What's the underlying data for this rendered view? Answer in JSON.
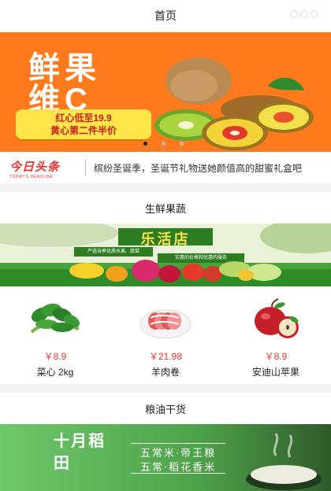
{
  "nav": {
    "title": "首页"
  },
  "banner": {
    "headline_line1": "鲜果",
    "headline_line2": "维C",
    "tag_line1": "红心低至19.9",
    "tag_line2": "黄心第二件半价",
    "slide_count": 3,
    "active_slide": 1
  },
  "news": {
    "logo_text": "今日头条",
    "logo_sub": "TODAY'S HEADLINE",
    "message": "缤纷圣诞季，圣诞节礼物送她颜值高的甜蜜礼盒吧"
  },
  "sections": [
    {
      "title": "生鲜果蔬",
      "banner_text": "乐活店",
      "banner_sub1": "严选当季优质水果、蔬菜",
      "banner_sub2": "实惠的价格和优惠的服务",
      "products": [
        {
          "price": "￥8.9",
          "name": "菜心 2kg",
          "icon": "vegetable-icon"
        },
        {
          "price": "￥21.98",
          "name": "羊肉卷",
          "icon": "lamb-roll-icon"
        },
        {
          "price": "￥8.9",
          "name": "安迪山苹果",
          "icon": "apple-icon"
        }
      ]
    },
    {
      "title": "粮油干货",
      "banner_brand": "十月稻田",
      "banner_text1": "五常米·帝王粮",
      "banner_text2": "五常·稻花香米"
    }
  ],
  "colors": {
    "banner_orange": "#ff7a1c",
    "price_red": "#e33333",
    "news_red": "#e8342c",
    "grain_green": "#3f7a3c"
  }
}
